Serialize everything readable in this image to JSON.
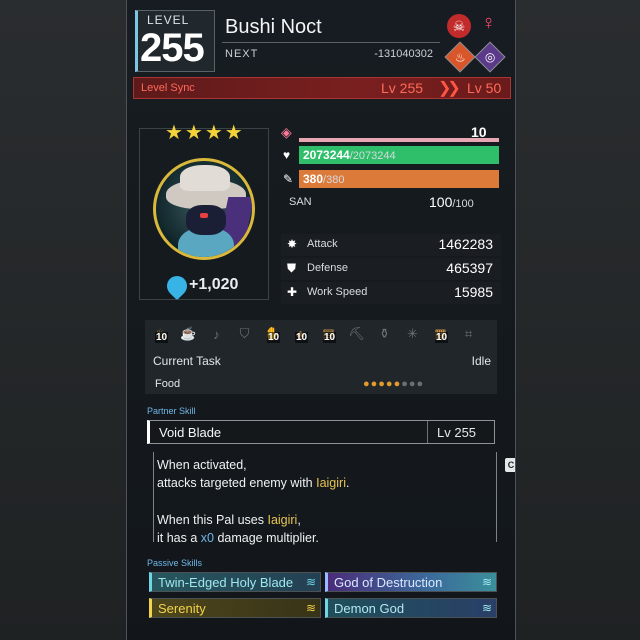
{
  "header": {
    "level_label": "LEVEL",
    "level": "255",
    "name": "Bushi Noct",
    "next_label": "NEXT",
    "next_value": "-131040302",
    "gender": "♀"
  },
  "level_sync": {
    "label": "Level Sync",
    "from": "Lv 255",
    "to": "Lv 50"
  },
  "portrait": {
    "stars": "★★★★",
    "trust_value": "+1,020"
  },
  "stats": {
    "rank": "10",
    "hp_current": "2073244",
    "hp_max": "/2073244",
    "sp_current": "380",
    "sp_max": "/380",
    "san_label": "SAN",
    "san_value": "100",
    "san_max": "/100",
    "attack_label": "Attack",
    "attack_value": "1462283",
    "defense_label": "Defense",
    "defense_value": "465397",
    "workspeed_label": "Work Speed",
    "workspeed_value": "15985"
  },
  "work": {
    "suitabilities": [
      {
        "icon": "kindling-icon",
        "glyph": "♨",
        "level": "10",
        "active": true
      },
      {
        "icon": "watering-icon",
        "glyph": "☕",
        "level": "",
        "active": false
      },
      {
        "icon": "planting-icon",
        "glyph": "♪",
        "level": "",
        "active": false
      },
      {
        "icon": "electricity-icon",
        "glyph": "⛉",
        "level": "",
        "active": false
      },
      {
        "icon": "handiwork-icon",
        "glyph": "✋",
        "level": "10",
        "active": true
      },
      {
        "icon": "gathering-icon",
        "glyph": "♣",
        "level": "10",
        "active": true
      },
      {
        "icon": "lumbering-icon",
        "glyph": "▤",
        "level": "10",
        "active": true
      },
      {
        "icon": "mining-icon",
        "glyph": "⛏",
        "level": "",
        "active": false
      },
      {
        "icon": "medicine-icon",
        "glyph": "⚱",
        "level": "",
        "active": false
      },
      {
        "icon": "cooling-icon",
        "glyph": "✳",
        "level": "",
        "active": false
      },
      {
        "icon": "transporting-icon",
        "glyph": "▦",
        "level": "10",
        "active": true
      },
      {
        "icon": "farming-icon",
        "glyph": "⌗",
        "level": "",
        "active": false
      }
    ],
    "task_label": "Current Task",
    "task_value": "Idle",
    "food_label": "Food",
    "food_filled": "●●●●●",
    "food_empty": "●●●"
  },
  "partner_skill": {
    "section_label": "Partner Skill",
    "name": "Void Blade",
    "level": "Lv  255",
    "desc1a": "When activated,",
    "desc2a": "attacks targeted enemy with ",
    "desc2b": "Iaigiri",
    "desc2c": ".",
    "desc3a": "When this Pal uses ",
    "desc3b": "Iaigiri",
    "desc3c": ",",
    "desc4a": "it has a ",
    "desc4b": "x0",
    "desc4c": " damage multiplier.",
    "tab": "C"
  },
  "passive_skills": {
    "section_label": "Passive Skills",
    "items": [
      {
        "name": "Twin-Edged Holy Blade",
        "color": "#6fd5e2"
      },
      {
        "name": "God of Destruction",
        "color": "#9ab8ff"
      },
      {
        "name": "Serenity",
        "color": "#f3d34a"
      },
      {
        "name": "Demon God",
        "color": "#6fd5e2"
      }
    ]
  }
}
